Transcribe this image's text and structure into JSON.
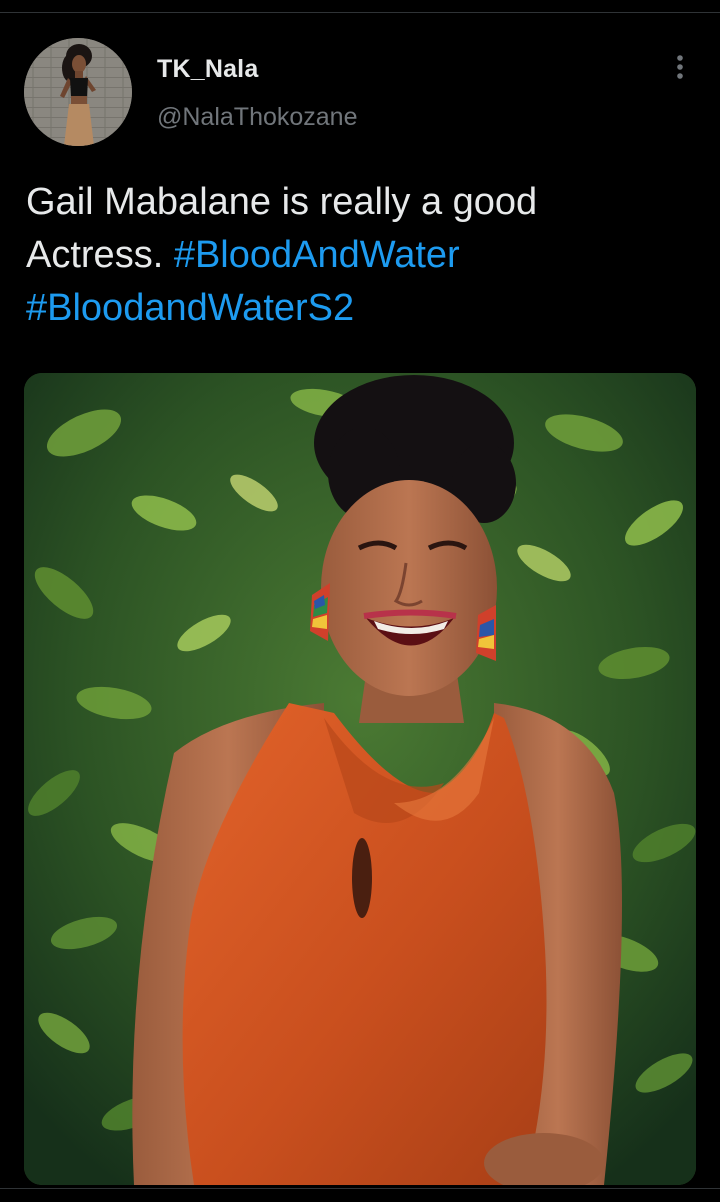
{
  "author": {
    "display_name": "TK_Nala",
    "handle": "@NalaThokozane"
  },
  "tweet": {
    "text_line1": "Gail Mabalane is really a good",
    "text_line2": "Actress.",
    "hashtags": [
      "#BloodAndWater",
      "#BloodandWaterS2"
    ]
  },
  "icons": {
    "more": "more-vertical-icon"
  },
  "colors": {
    "background": "#000000",
    "text": "#e7e9ea",
    "secondary_text": "#71767b",
    "hashtag": "#1d9bf0",
    "divider": "#2f3336"
  }
}
